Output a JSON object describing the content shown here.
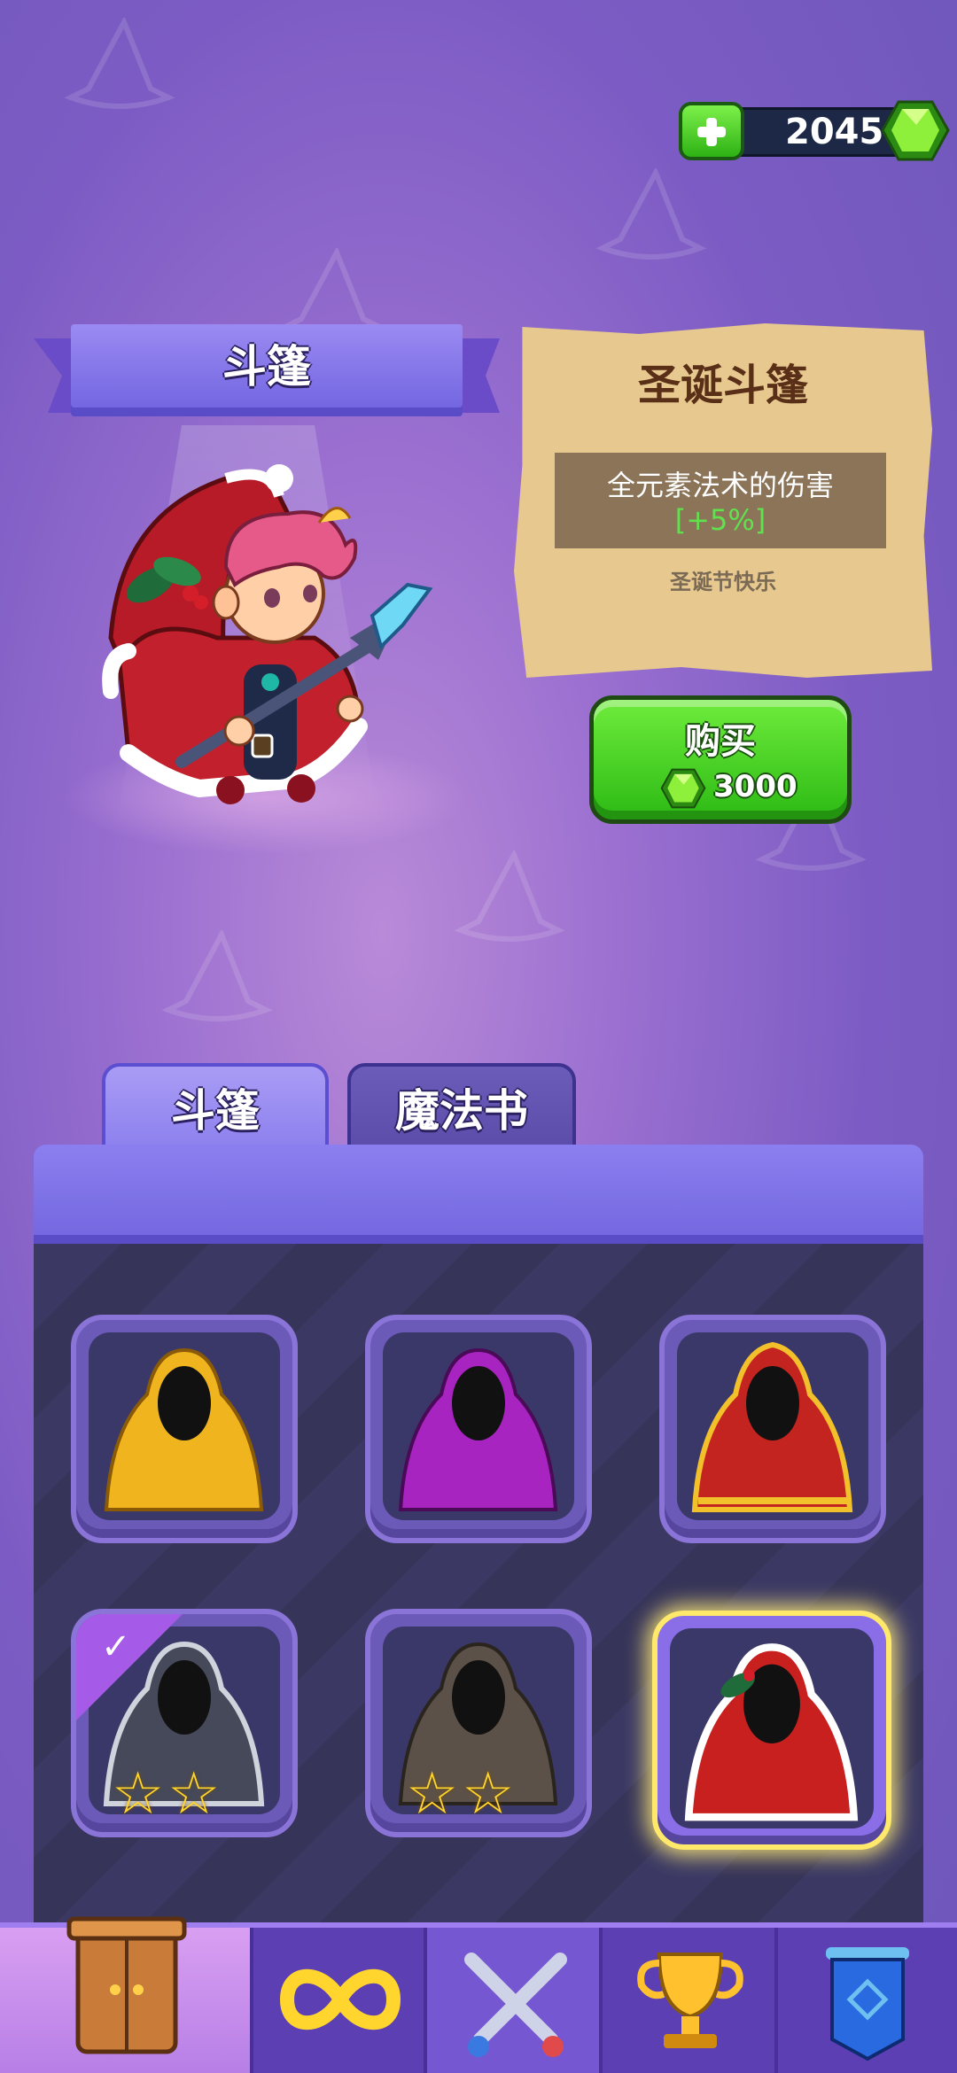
{
  "currency": {
    "amount": "2045",
    "plus_icon": "plus-icon",
    "gem_icon": "gem-icon"
  },
  "category_banner": {
    "title": "斗篷"
  },
  "item_info": {
    "name": "圣诞斗篷",
    "effect": "全元素法术的伤害",
    "bonus": "[+5%]",
    "flavor": "圣诞节快乐"
  },
  "buy_button": {
    "label": "购买",
    "price": "3000"
  },
  "tabs": [
    {
      "label": "斗篷",
      "active": true
    },
    {
      "label": "魔法书",
      "active": false
    }
  ],
  "cloaks": [
    {
      "name": "yellow-cloak",
      "color": "#f0b51e",
      "equipped": false,
      "stars": "",
      "selected": false
    },
    {
      "name": "purple-cloak",
      "color": "#a824c0",
      "equipped": false,
      "stars": "",
      "selected": false
    },
    {
      "name": "red-gold-cloak",
      "color": "#c42420",
      "equipped": false,
      "stars": "",
      "selected": false
    },
    {
      "name": "grey-white-cloak",
      "color": "#45495a",
      "equipped": true,
      "stars": "☆☆",
      "selected": false
    },
    {
      "name": "brown-cloak",
      "color": "#5c5148",
      "equipped": false,
      "stars": "☆☆",
      "selected": false
    },
    {
      "name": "christmas-cloak",
      "color": "#c8201e",
      "equipped": false,
      "stars": "",
      "selected": true
    }
  ],
  "nav": [
    {
      "icon": "wardrobe-icon",
      "active": true
    },
    {
      "icon": "infinity-icon",
      "active": false
    },
    {
      "icon": "crossed-swords-icon",
      "active": false
    },
    {
      "icon": "trophy-icon",
      "active": false
    },
    {
      "icon": "banner-icon",
      "active": false
    }
  ],
  "colors": {
    "accent_green": "#2eb215",
    "bonus_green": "#60e24e",
    "selected_glow": "#ffe86a"
  }
}
